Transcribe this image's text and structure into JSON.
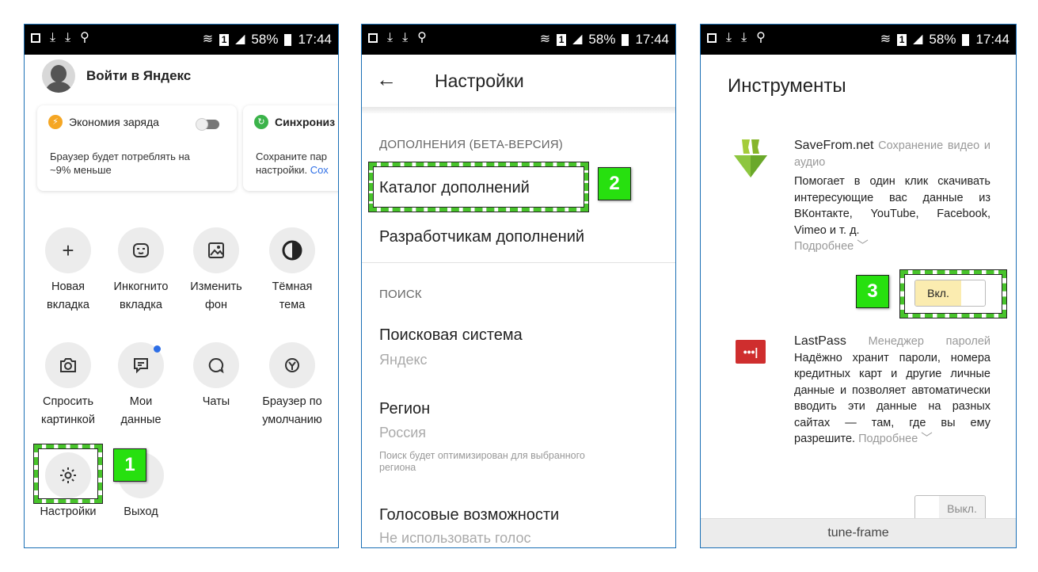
{
  "status_bar": {
    "battery": "58%",
    "time": "17:44",
    "sim": "1"
  },
  "panel1": {
    "account_label": "Войти в Яндекс",
    "cards": [
      {
        "title": "Экономия заряда",
        "body_line1": "Браузер будет потреблять на",
        "body_line2": "~9% меньше",
        "icon_color": "#f5a623"
      },
      {
        "title": "Синхрониз",
        "body_line1": "Сохраните пар",
        "body_line2": "настройки.",
        "link": "Сох",
        "icon_color": "#3bb34a"
      }
    ],
    "tiles": [
      {
        "line1": "Новая",
        "line2": "вкладка",
        "icon": "plus-icon"
      },
      {
        "line1": "Инкогнито",
        "line2": "вкладка",
        "icon": "mask-icon"
      },
      {
        "line1": "Изменить",
        "line2": "фон",
        "icon": "image-icon"
      },
      {
        "line1": "Тёмная",
        "line2": "тема",
        "icon": "contrast-icon"
      },
      {
        "line1": "Спросить",
        "line2": "картинкой",
        "icon": "camera-search-icon"
      },
      {
        "line1": "Мои данные",
        "line2": "",
        "icon": "data-icon"
      },
      {
        "line1": "Чаты",
        "line2": "",
        "icon": "chat-icon"
      },
      {
        "line1": "Браузер по",
        "line2": "умолчанию",
        "icon": "default-browser-icon"
      },
      {
        "line1": "Настройки",
        "line2": "",
        "icon": "gear-icon"
      },
      {
        "line1": "Выход",
        "line2": "",
        "icon": "exit-icon"
      }
    ],
    "badge": "1"
  },
  "panel2": {
    "title": "Настройки",
    "section_addons": "ДОПОЛНЕНИЯ (БЕТА-ВЕРСИЯ)",
    "catalog": "Каталог дополнений",
    "developers": "Разработчикам дополнений",
    "section_search": "ПОИСК",
    "search_engine": "Поисковая система",
    "search_engine_value": "Яндекс",
    "region": "Регион",
    "region_value": "Россия",
    "region_note_line1": "Поиск будет оптимизирован для выбранного",
    "region_note_line2": "региона",
    "voice": "Голосовые возможности",
    "voice_value": "Не использовать голос",
    "badge": "2"
  },
  "panel3": {
    "title": "Инструменты",
    "ext1": {
      "name": "SaveFrom.net",
      "category": "Сохранение видео и аудио",
      "description": "Помогает в один клик скачивать интересующие вас данные из ВКонтакте, YouTube, Facebook, Vimeo и т. д.",
      "more": "Подробнее",
      "toggle_label": "Вкл."
    },
    "ext2": {
      "name": "LastPass",
      "category": "Менеджер паролей",
      "description": "Надёжно хранит пароли, номера кредитных карт и другие личные данные и позволяет автоматически вводить эти данные на разных сайтах — там, где вы ему разрешите.",
      "more": "Подробнее",
      "toggle_label": "Выкл."
    },
    "footer": "tune-frame",
    "badge": "3"
  }
}
